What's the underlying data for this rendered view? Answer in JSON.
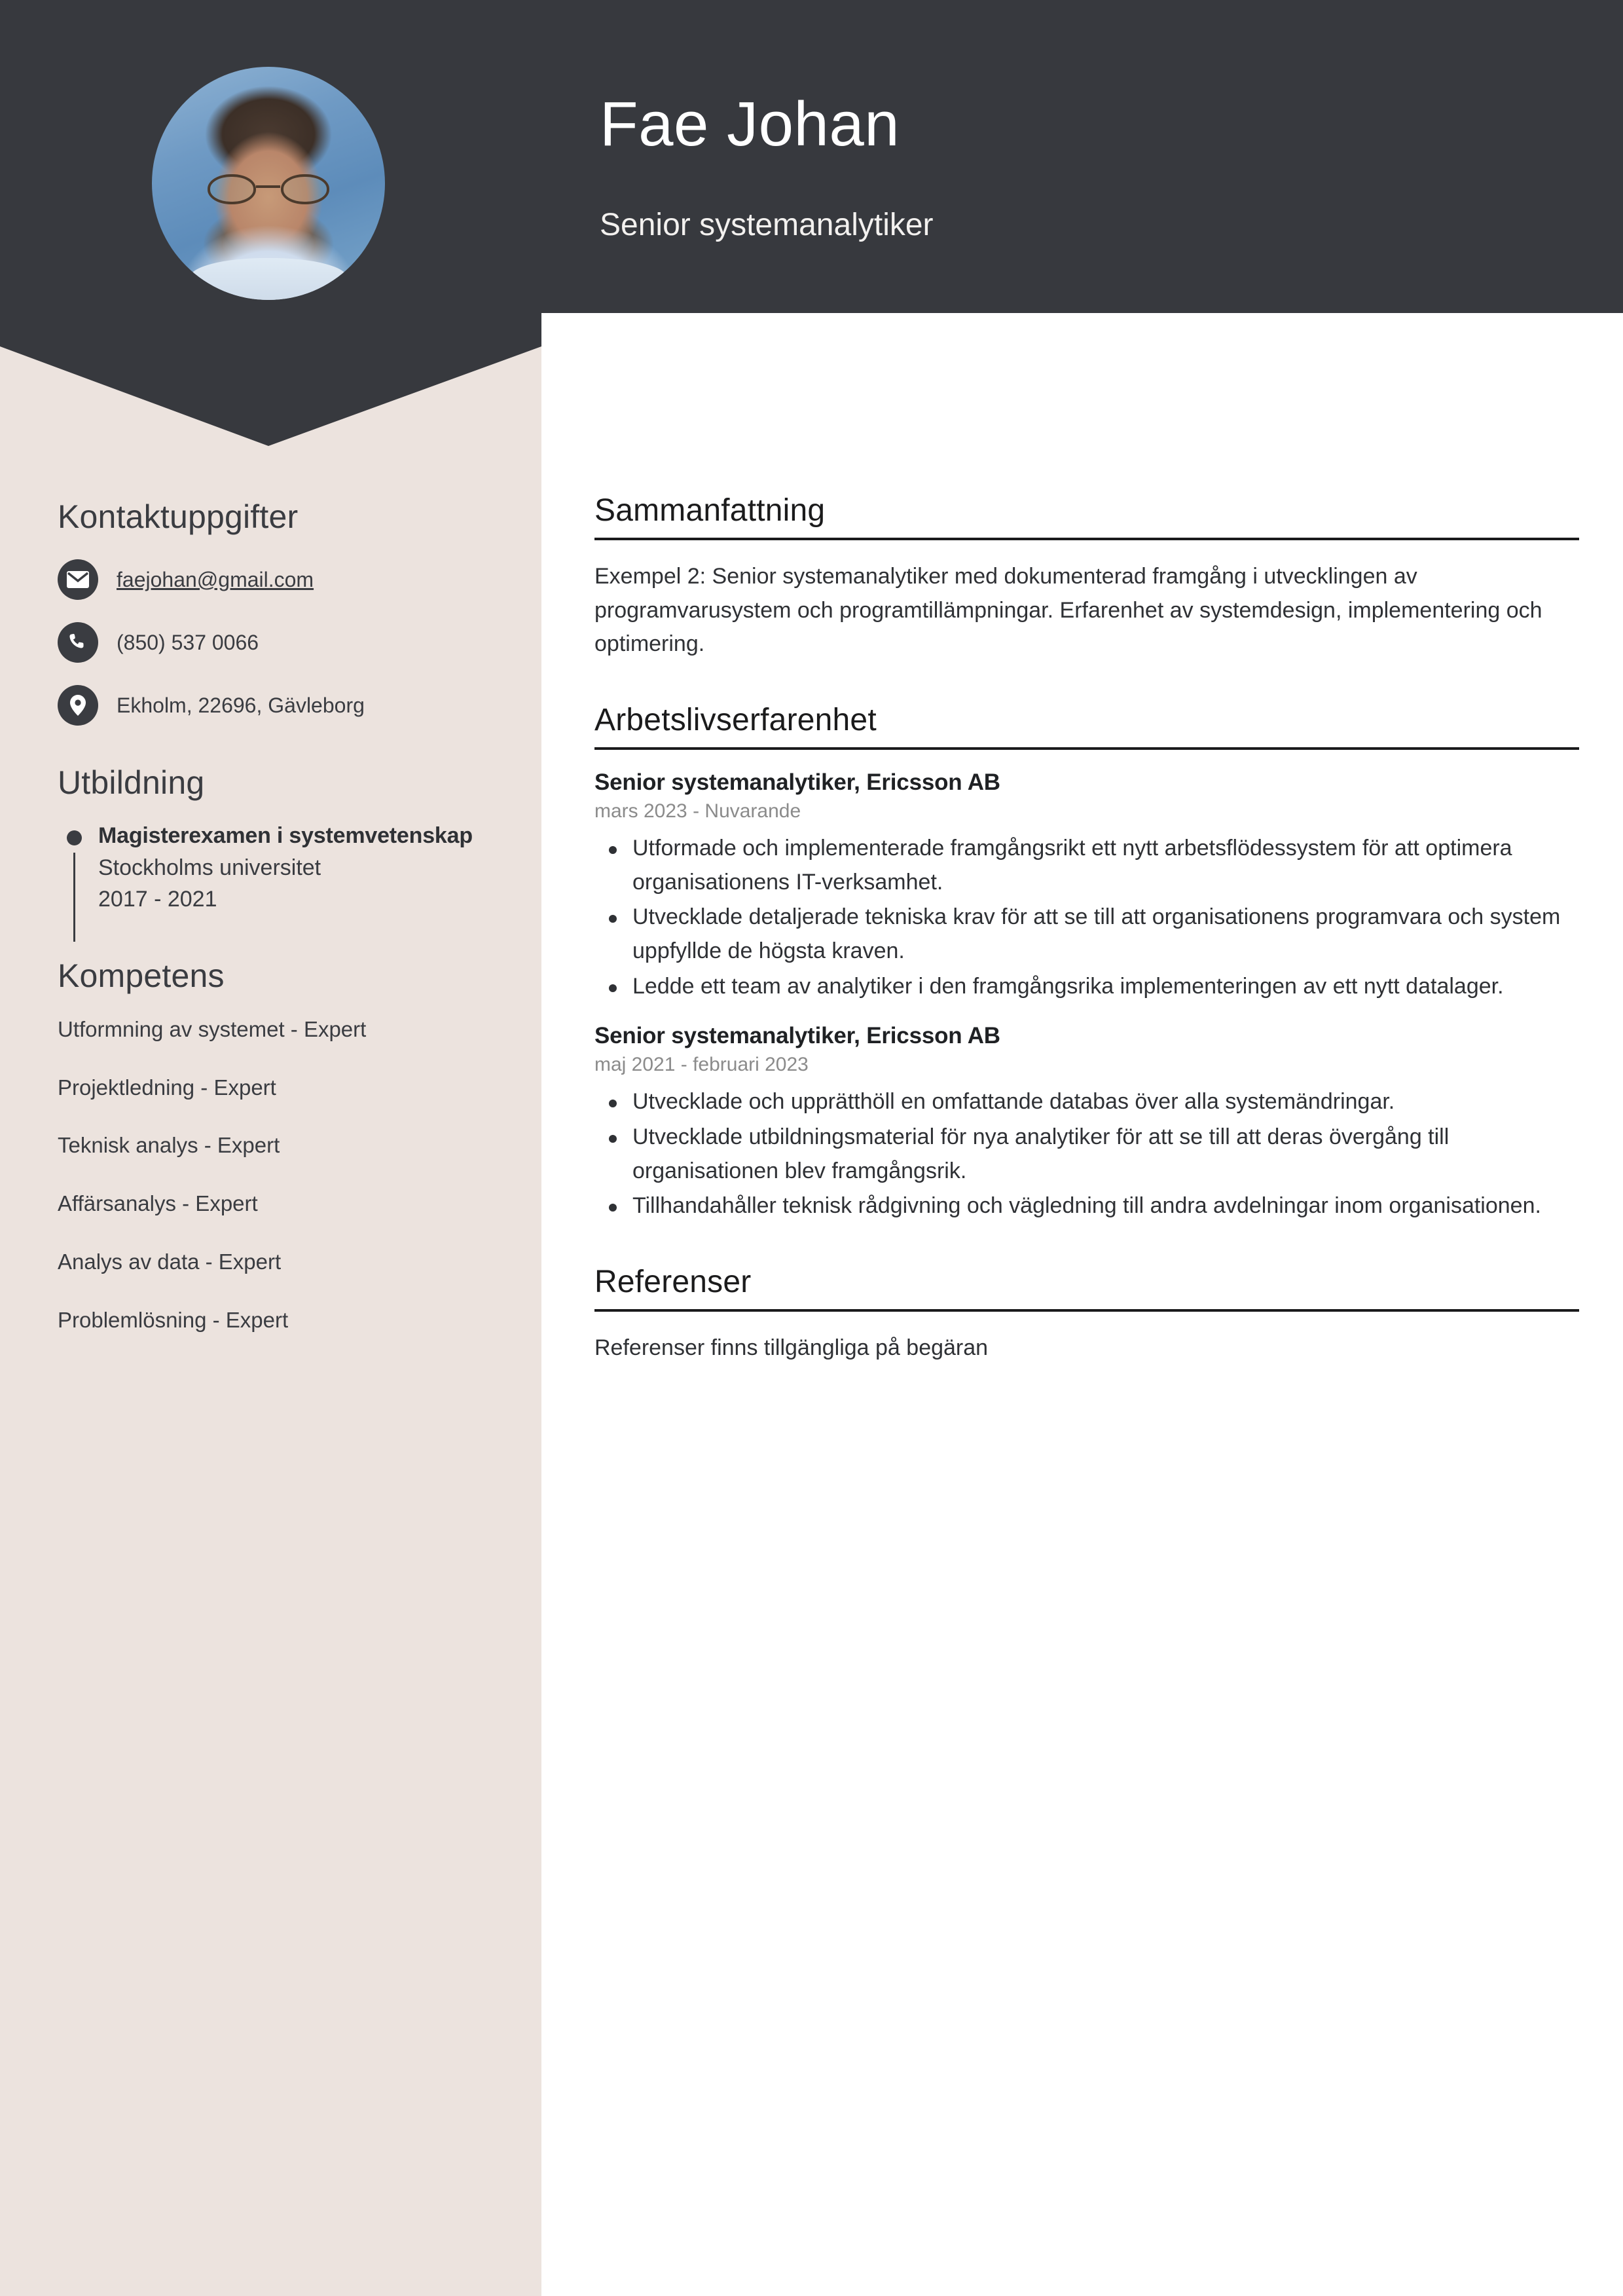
{
  "header": {
    "name": "Fae Johan",
    "role": "Senior systemanalytiker",
    "bg_color": "#37393E",
    "avatar_alt": "profile-photo"
  },
  "theme": {
    "sidebar_bg": "#ECE3DE",
    "dark": "#37393E",
    "text": "#3a3c41",
    "muted": "#8b8b8b"
  },
  "sidebar": {
    "contact": {
      "heading": "Kontaktuppgifter",
      "items": [
        {
          "icon": "envelope-icon",
          "value": "faejohan@gmail.com",
          "link": true
        },
        {
          "icon": "phone-icon",
          "value": "(850) 537 0066",
          "link": false
        },
        {
          "icon": "map-pin-icon",
          "value": "Ekholm, 22696, Gävleborg",
          "link": false
        }
      ]
    },
    "education": {
      "heading": "Utbildning",
      "entries": [
        {
          "degree": "Magisterexamen i systemvetenskap",
          "school": "Stockholms universitet",
          "years": "2017 - 2021"
        }
      ]
    },
    "skills": {
      "heading": "Kompetens",
      "items": [
        "Utformning av systemet - Expert",
        "Projektledning - Expert",
        "Teknisk analys - Expert",
        "Affärsanalys - Expert",
        "Analys av data - Expert",
        "Problemlösning - Expert"
      ]
    }
  },
  "main": {
    "summary": {
      "heading": "Sammanfattning",
      "text": "Exempel 2: Senior systemanalytiker med dokumenterad framgång i utvecklingen av programvarusystem och programtillämpningar. Erfarenhet av systemdesign, implementering och optimering."
    },
    "experience": {
      "heading": "Arbetslivserfarenhet",
      "jobs": [
        {
          "title": "Senior systemanalytiker, Ericsson AB",
          "date": "mars 2023 - Nuvarande",
          "bullets": [
            "Utformade och implementerade framgångsrikt ett nytt arbetsflödessystem för att optimera organisationens IT-verksamhet.",
            "Utvecklade detaljerade tekniska krav för att se till att organisationens programvara och system uppfyllde de högsta kraven.",
            "Ledde ett team av analytiker i den framgångsrika implementeringen av ett nytt datalager."
          ]
        },
        {
          "title": "Senior systemanalytiker, Ericsson AB",
          "date": "maj 2021 - februari 2023",
          "bullets": [
            "Utvecklade och upprätthöll en omfattande databas över alla systemändringar.",
            "Utvecklade utbildningsmaterial för nya analytiker för att se till att deras övergång till organisationen blev framgångsrik.",
            "Tillhandahåller teknisk rådgivning och vägledning till andra avdelningar inom organisationen."
          ]
        }
      ]
    },
    "references": {
      "heading": "Referenser",
      "text": "Referenser finns tillgängliga på begäran"
    }
  }
}
